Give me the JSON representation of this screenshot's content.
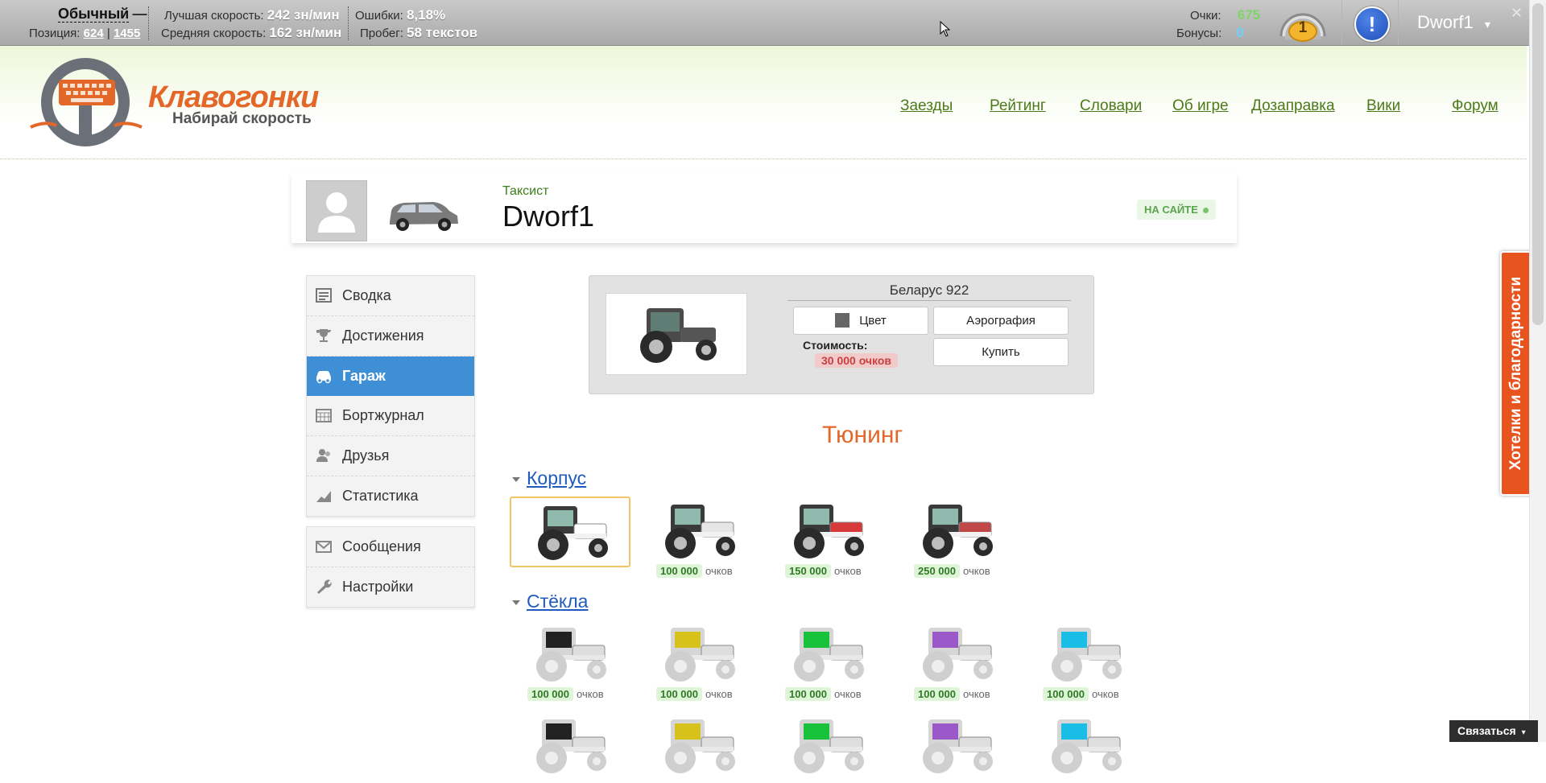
{
  "topbar": {
    "mode": "Обычный",
    "mode_dash": "—",
    "position_label": "Позиция:",
    "position_value": "624",
    "position_sep": "|",
    "position_total": "1455",
    "best_speed_label": "Лучшая скорость:",
    "best_speed_value": "242 зн/мин",
    "avg_speed_label": "Средняя скорость:",
    "avg_speed_value": "162 зн/мин",
    "errors_label": "Ошибки:",
    "errors_value": "8,18%",
    "mileage_label": "Пробег:",
    "mileage_value": "58 текстов",
    "points_label": "Очки:",
    "points_value": "675",
    "bonuses_label": "Бонусы:",
    "bonuses_value": "0",
    "level_value": "1",
    "notice_glyph": "!",
    "username": "Dworf1",
    "dropdown_glyph": "▾",
    "close_glyph": "✕"
  },
  "logo": {
    "title": "Клавогонки",
    "subtitle": "Набирай скорость"
  },
  "nav": [
    "Заезды",
    "Рейтинг",
    "Словари",
    "Об игре",
    "Дозаправка",
    "Вики",
    "Форум"
  ],
  "profile": {
    "rank": "Таксист",
    "name": "Dworf1",
    "status": "НА САЙТЕ"
  },
  "menu_main": [
    {
      "label": "Сводка",
      "icon": "summary-icon"
    },
    {
      "label": "Достижения",
      "icon": "trophy-icon"
    },
    {
      "label": "Гараж",
      "icon": "car-icon",
      "active": true
    },
    {
      "label": "Бортжурнал",
      "icon": "calendar-icon"
    },
    {
      "label": "Друзья",
      "icon": "friends-icon"
    },
    {
      "label": "Статистика",
      "icon": "chart-icon"
    }
  ],
  "menu_secondary": [
    {
      "label": "Сообщения",
      "icon": "envelope-icon"
    },
    {
      "label": "Настройки",
      "icon": "wrench-icon"
    }
  ],
  "car": {
    "name": "Беларус 922",
    "color_button": "Цвет",
    "airbrush_button": "Аэрография",
    "cost_label": "Стоимость:",
    "cost_value": "30 000 очков",
    "buy_button": "Купить"
  },
  "tuning": {
    "title": "Тюнинг",
    "unit": "очков",
    "sections": [
      {
        "title": "Корпус",
        "items": [
          {
            "price": "",
            "selected": true,
            "accent": "#ffffff"
          },
          {
            "price": "100 000",
            "accent": "#e6e6e6"
          },
          {
            "price": "150 000",
            "accent": "#d83a3a"
          },
          {
            "price": "250 000",
            "accent": "#c24848"
          }
        ]
      },
      {
        "title": "Стёкла",
        "items": [
          {
            "price": "100 000",
            "accent": "#222222"
          },
          {
            "price": "100 000",
            "accent": "#d6c21a"
          },
          {
            "price": "100 000",
            "accent": "#19c23b"
          },
          {
            "price": "100 000",
            "accent": "#9a58c9"
          },
          {
            "price": "100 000",
            "accent": "#19bde6"
          }
        ]
      }
    ]
  },
  "side_tab": "Хотелки и благодарности",
  "contact_button": "Связаться",
  "colors": {
    "accent_orange": "#e4672a",
    "menu_active": "#3e8fd6",
    "nav_green": "#4c7a1a"
  }
}
